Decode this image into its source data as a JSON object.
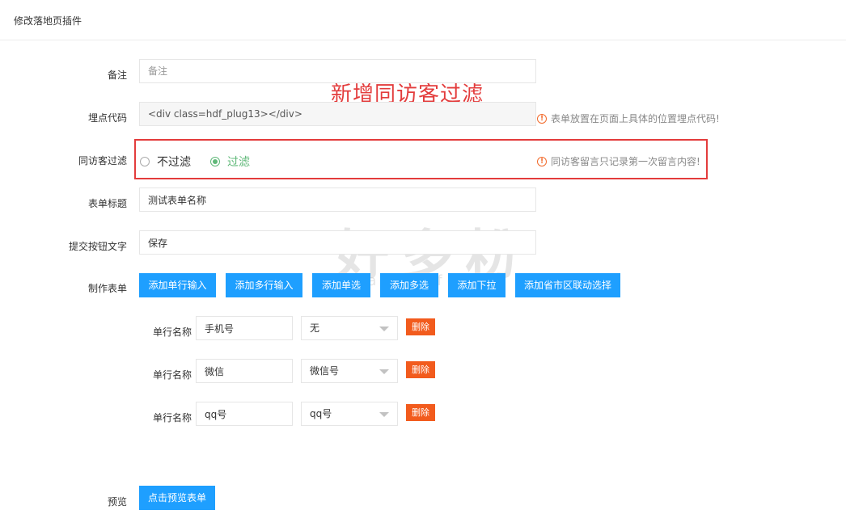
{
  "header": {
    "title": "修改落地页插件"
  },
  "annotation": "新增同访客过滤",
  "watermark": {
    "main": "好多粉",
    "sub": "haoduofen"
  },
  "form": {
    "remark": {
      "label": "备注",
      "placeholder": "备注"
    },
    "embed_code": {
      "label": "埋点代码",
      "value": "<div class=hdf_plug13></div>",
      "hint": "表单放置在页面上具体的位置埋点代码!"
    },
    "visitor_filter": {
      "label": "同访客过滤",
      "options": [
        {
          "label": "不过滤",
          "checked": false
        },
        {
          "label": "过滤",
          "checked": true
        }
      ],
      "hint": "同访客留言只记录第一次留言内容!"
    },
    "form_title": {
      "label": "表单标题",
      "value": "测试表单名称"
    },
    "submit_text": {
      "label": "提交按钮文字",
      "value": "保存"
    },
    "builder": {
      "label": "制作表单",
      "buttons": [
        "添加单行输入",
        "添加多行输入",
        "添加单选",
        "添加多选",
        "添加下拉",
        "添加省市区联动选择"
      ]
    },
    "rows": [
      {
        "label": "单行名称",
        "name": "手机号",
        "select": "无",
        "delete": "删除"
      },
      {
        "label": "单行名称",
        "name": "微信",
        "select": "微信号",
        "delete": "删除"
      },
      {
        "label": "单行名称",
        "name": "qq号",
        "select": "qq号",
        "delete": "删除"
      }
    ],
    "preview": {
      "label": "预览",
      "button": "点击预览表单"
    }
  },
  "colors": {
    "accent": "#1e9fff",
    "danger": "#f25b1d",
    "highlight": "#e33c3c",
    "checked": "#5fb878"
  }
}
